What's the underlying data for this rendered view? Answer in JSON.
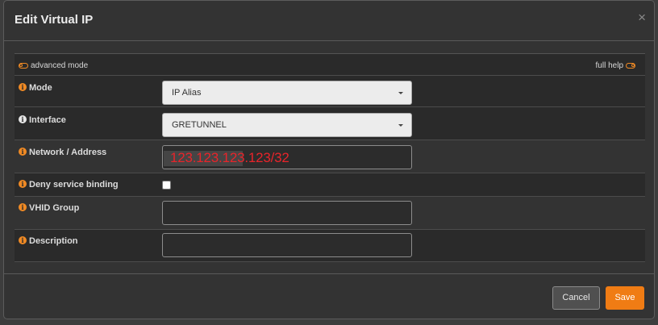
{
  "modal": {
    "title": "Edit Virtual IP",
    "close_glyph": "×"
  },
  "toolbar": {
    "advanced_mode": "advanced mode",
    "full_help": "full help"
  },
  "fields": {
    "mode": {
      "label": "Mode",
      "value": "IP Alias",
      "icon": "info-icon",
      "icon_color": "#f08a24"
    },
    "interface": {
      "label": "Interface",
      "value": "GRETUNNEL",
      "icon": "info-icon",
      "icon_color": "#e6e6e6"
    },
    "network": {
      "label": "Network / Address",
      "value": "123.123.123.123/32",
      "icon": "info-icon",
      "icon_color": "#f08a24"
    },
    "deny": {
      "label": "Deny service binding",
      "checked": false,
      "icon": "info-icon",
      "icon_color": "#f08a24"
    },
    "vhid": {
      "label": "VHID Group",
      "value": "",
      "icon": "info-icon",
      "icon_color": "#f08a24"
    },
    "description": {
      "label": "Description",
      "value": "",
      "icon": "info-icon",
      "icon_color": "#f08a24"
    }
  },
  "info_glyph": "i",
  "buttons": {
    "cancel": "Cancel",
    "save": "Save"
  },
  "colors": {
    "accent": "#f07c14",
    "overlay_text": "#e8242a"
  }
}
